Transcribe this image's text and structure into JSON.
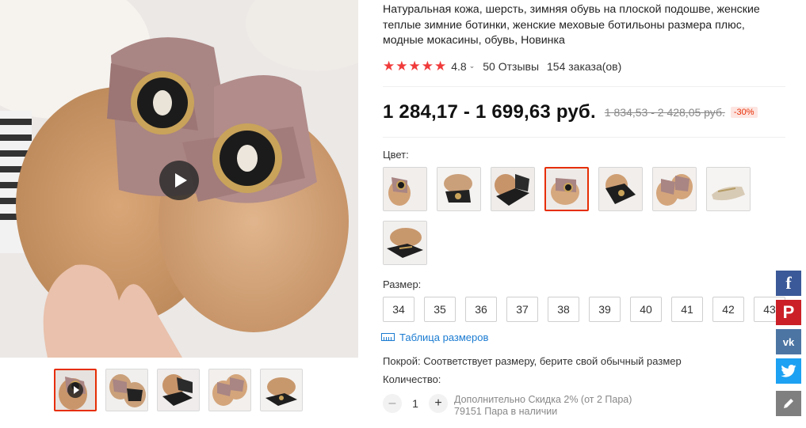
{
  "product": {
    "title": "Натуральная кожа, шерсть, зимняя обувь на плоской подошве, женские теплые зимние ботинки, женские меховые ботильоны размера плюс, модные мокасины, обувь, Новинка",
    "rating": "4.8",
    "reviews": "50 Отзывы",
    "orders": "154 заказа(ов)",
    "price": "1 284,17 - 1 699,63 руб.",
    "old_price": "1 834,53 - 2 428,05 руб.",
    "discount": "-30%"
  },
  "options": {
    "color_label": "Цвет:",
    "selected_color_index": 3,
    "color_count": 8,
    "size_label": "Размер:",
    "sizes": [
      "34",
      "35",
      "36",
      "37",
      "38",
      "39",
      "40",
      "41",
      "42",
      "43"
    ],
    "size_chart_label": "Таблица размеров",
    "fit_text": "Покрой: Соответствует размеру, берите свой обычный размер"
  },
  "quantity": {
    "label": "Количество:",
    "minus": "–",
    "value": "1",
    "plus": "+",
    "note_line1": "Дополнительно Скидка 2% (от 2 Пара)",
    "note_line2": "79151 Пара в наличии"
  },
  "media": {
    "thumbnail_count": 5,
    "active_thumbnail": 0
  },
  "social": {
    "facebook": "f",
    "pinterest": "P",
    "vk": "vk"
  },
  "colors": {
    "accent": "#e62e04",
    "star": "#f03a3a",
    "link": "#1a7bd1"
  }
}
